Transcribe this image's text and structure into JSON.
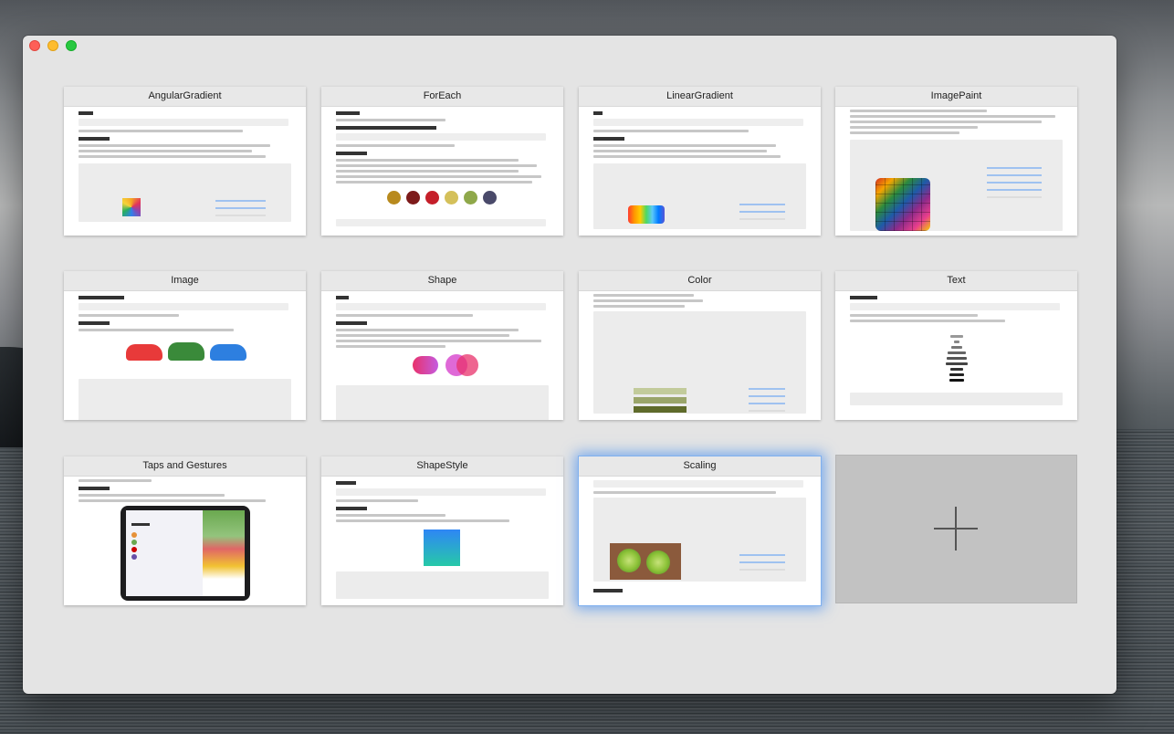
{
  "cards": [
    {
      "title": "AngularGradient"
    },
    {
      "title": "ForEach"
    },
    {
      "title": "LinearGradient"
    },
    {
      "title": "ImagePaint"
    },
    {
      "title": "Image"
    },
    {
      "title": "Shape"
    },
    {
      "title": "Color"
    },
    {
      "title": "Text"
    },
    {
      "title": "Taps and Gestures"
    },
    {
      "title": "ShapeStyle"
    },
    {
      "title": "Scaling"
    }
  ],
  "selected_card": "Scaling",
  "add_card": {
    "icon": "plus-icon"
  },
  "colors": {
    "selection": "#3a87f0",
    "close": "#fe5f57",
    "minimize": "#febc2e",
    "maximize": "#28c840"
  }
}
